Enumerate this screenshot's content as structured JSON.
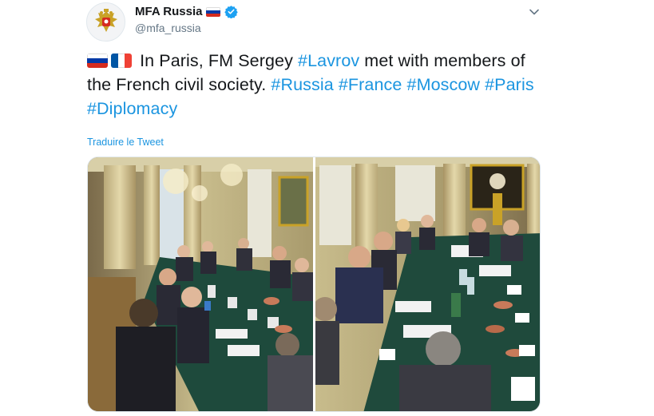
{
  "user": {
    "display_name": "MFA Russia",
    "handle": "@mfa_russia",
    "avatar_icon": "russian-coat-of-arms-icon",
    "verified_icon": "verified-badge-icon"
  },
  "tweet": {
    "segments": [
      {
        "text": "In Paris, FM Sergey ",
        "type": "text"
      },
      {
        "text": "#Lavrov",
        "type": "hashtag"
      },
      {
        "text": " met with members of the French civil society. ",
        "type": "text"
      },
      {
        "text": "#Russia",
        "type": "hashtag"
      },
      {
        "text": " ",
        "type": "text"
      },
      {
        "text": "#France",
        "type": "hashtag"
      },
      {
        "text": " ",
        "type": "text"
      },
      {
        "text": "#Moscow",
        "type": "hashtag"
      },
      {
        "text": " ",
        "type": "text"
      },
      {
        "text": "#Paris",
        "type": "hashtag"
      },
      {
        "text": " ",
        "type": "text"
      },
      {
        "text": "#Diplomacy",
        "type": "hashtag"
      }
    ],
    "translate_label": "Traduire le Tweet"
  },
  "colors": {
    "link": "#1b95e0",
    "text": "#14171a",
    "secondary": "#657786",
    "verified": "#1da1f2"
  },
  "media": {
    "photos": [
      "meeting-photo-left",
      "meeting-photo-right"
    ]
  }
}
